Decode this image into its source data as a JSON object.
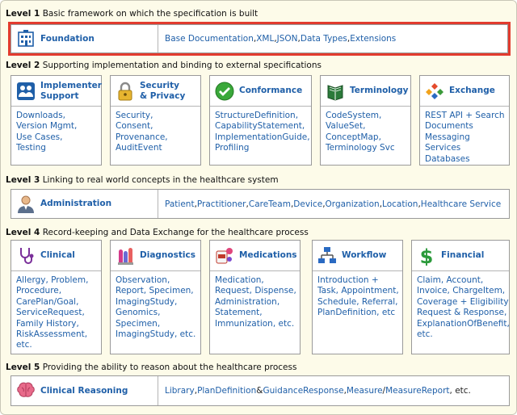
{
  "level1": {
    "label": "Level 1",
    "desc": "Basic framework on which the specification is built",
    "foundation": {
      "title": "Foundation",
      "items": [
        {
          "text": "Base Documentation",
          "link": true
        },
        {
          "text": ", ",
          "link": false
        },
        {
          "text": "XML",
          "link": true
        },
        {
          "text": ", ",
          "link": false
        },
        {
          "text": "JSON",
          "link": true
        },
        {
          "text": ", ",
          "link": false
        },
        {
          "text": "Data Types",
          "link": true
        },
        {
          "text": ", ",
          "link": false
        },
        {
          "text": "Extensions",
          "link": true
        }
      ]
    }
  },
  "level2": {
    "label": "Level 2",
    "desc": "Supporting implementation and binding to external specifications",
    "cards": [
      {
        "title_lines": [
          "Implementer",
          "Support"
        ],
        "lines": [
          "Downloads,",
          "Version Mgmt,",
          "Use Cases,",
          "Testing"
        ]
      },
      {
        "title_lines": [
          "Security",
          "& Privacy"
        ],
        "lines": [
          "Security,",
          "Consent,",
          "Provenance,",
          "AuditEvent"
        ]
      },
      {
        "title_lines": [
          "Conformance"
        ],
        "lines": [
          "StructureDefinition,",
          "CapabilityStatement,",
          "ImplementationGuide,",
          "Profiling"
        ]
      },
      {
        "title_lines": [
          "Terminology"
        ],
        "lines": [
          "CodeSystem,",
          "ValueSet,",
          "ConceptMap,",
          "Terminology Svc"
        ]
      },
      {
        "title_lines": [
          "Exchange"
        ],
        "lines": [
          "REST API + Search",
          "Documents",
          "Messaging",
          "Services",
          "Databases"
        ]
      }
    ]
  },
  "level3": {
    "label": "Level 3",
    "desc": "Linking to real world concepts in the healthcare system",
    "administration": {
      "title": "Administration",
      "items": [
        {
          "text": "Patient",
          "link": true
        },
        {
          "text": ", ",
          "link": false
        },
        {
          "text": "Practitioner",
          "link": true
        },
        {
          "text": ", ",
          "link": false
        },
        {
          "text": "CareTeam",
          "link": true
        },
        {
          "text": ", ",
          "link": false
        },
        {
          "text": "Device",
          "link": true
        },
        {
          "text": ", ",
          "link": false
        },
        {
          "text": "Organization",
          "link": true
        },
        {
          "text": ", ",
          "link": false
        },
        {
          "text": "Location",
          "link": true
        },
        {
          "text": ", ",
          "link": false
        },
        {
          "text": "Healthcare Service",
          "link": true
        }
      ]
    }
  },
  "level4": {
    "label": "Level 4",
    "desc": "Record-keeping and Data Exchange for the healthcare process",
    "cards": [
      {
        "title_lines": [
          "Clinical"
        ],
        "lines": [
          "Allergy, Problem,",
          "Procedure,",
          "CarePlan/Goal,",
          "ServiceRequest,",
          "Family History,",
          "RiskAssessment,",
          "etc."
        ]
      },
      {
        "title_lines": [
          "Diagnostics"
        ],
        "lines": [
          "Observation,",
          "Report, Specimen,",
          "ImagingStudy,",
          "Genomics,",
          "Specimen,",
          "ImagingStudy, etc."
        ]
      },
      {
        "title_lines": [
          "Medications"
        ],
        "lines": [
          "Medication,",
          "Request, Dispense,",
          "Administration,",
          "Statement,",
          "Immunization, etc."
        ]
      },
      {
        "title_lines": [
          "Workflow"
        ],
        "lines": [
          "Introduction +",
          "Task, Appointment,",
          "Schedule, Referral,",
          "PlanDefinition, etc"
        ]
      },
      {
        "title_lines": [
          "Financial"
        ],
        "lines": [
          "Claim, Account,",
          "Invoice, ChargeItem,",
          "Coverage + Eligibility",
          "Request & Response,",
          "ExplanationOfBenefit,",
          "etc."
        ]
      }
    ]
  },
  "level5": {
    "label": "Level 5",
    "desc": "Providing the ability to reason about the healthcare process",
    "reasoning": {
      "title": "Clinical Reasoning",
      "items": [
        {
          "text": "Library",
          "link": true
        },
        {
          "text": ", ",
          "link": false
        },
        {
          "text": "PlanDefinition",
          "link": true
        },
        {
          "text": " & ",
          "link": false
        },
        {
          "text": "GuidanceResponse",
          "link": true
        },
        {
          "text": ", ",
          "link": false
        },
        {
          "text": "Measure",
          "link": true
        },
        {
          "text": "/",
          "link": false
        },
        {
          "text": "MeasureReport",
          "link": true
        },
        {
          "text": ", etc.",
          "link": false
        }
      ]
    }
  },
  "colors": {
    "link": "#1f5fa8",
    "highlight": "#e23b2e",
    "background": "#fdfbe9"
  },
  "icons": [
    "building-icon",
    "users-icon",
    "lock-icon",
    "checkmark-icon",
    "book-icon",
    "exchange-icon",
    "person-icon",
    "stethoscope-icon",
    "test-tubes-icon",
    "pills-icon",
    "flowchart-icon",
    "dollar-icon",
    "brain-icon"
  ]
}
